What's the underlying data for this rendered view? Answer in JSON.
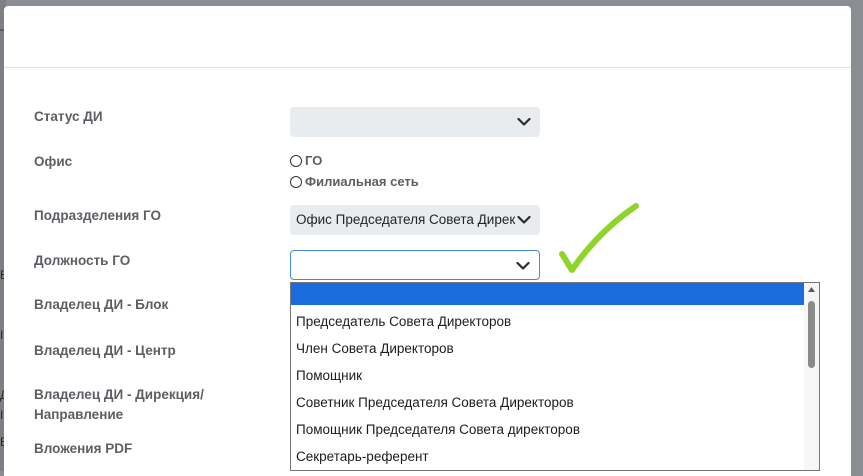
{
  "form": {
    "fields": [
      {
        "label": "Статус ДИ"
      },
      {
        "label": "Офис"
      },
      {
        "label": "Подразделения ГО"
      },
      {
        "label": "Должность ГО"
      },
      {
        "label": "Владелец ДИ - Блок"
      },
      {
        "label": "Владелец ДИ - Центр"
      },
      {
        "label": "Владелец ДИ - Дирекция/"
      },
      {
        "label": "Направление"
      },
      {
        "label": "Вложения PDF"
      }
    ],
    "status_select": {
      "value": ""
    },
    "office_radio": {
      "options": [
        "ГО",
        "Филиальная сеть"
      ]
    },
    "division_select": {
      "value": "Офис Председателя Совета Дирек"
    },
    "position_select": {
      "value": ""
    }
  },
  "dropdown": {
    "options": [
      "",
      "Председатель Совета Директоров",
      "Член Совета Директоров",
      "Помощник",
      "Советник Председателя Совета Директоров",
      "Помощник Председателя Совета директоров",
      "Секретарь-референт"
    ]
  },
  "colors": {
    "highlight": "#1a6cdc",
    "checkmark": "#8fd42a",
    "focus_border": "#4a89d4"
  },
  "icons": {
    "select_arrow": "chevron-down-icon",
    "annotation": "checkmark-icon"
  }
}
